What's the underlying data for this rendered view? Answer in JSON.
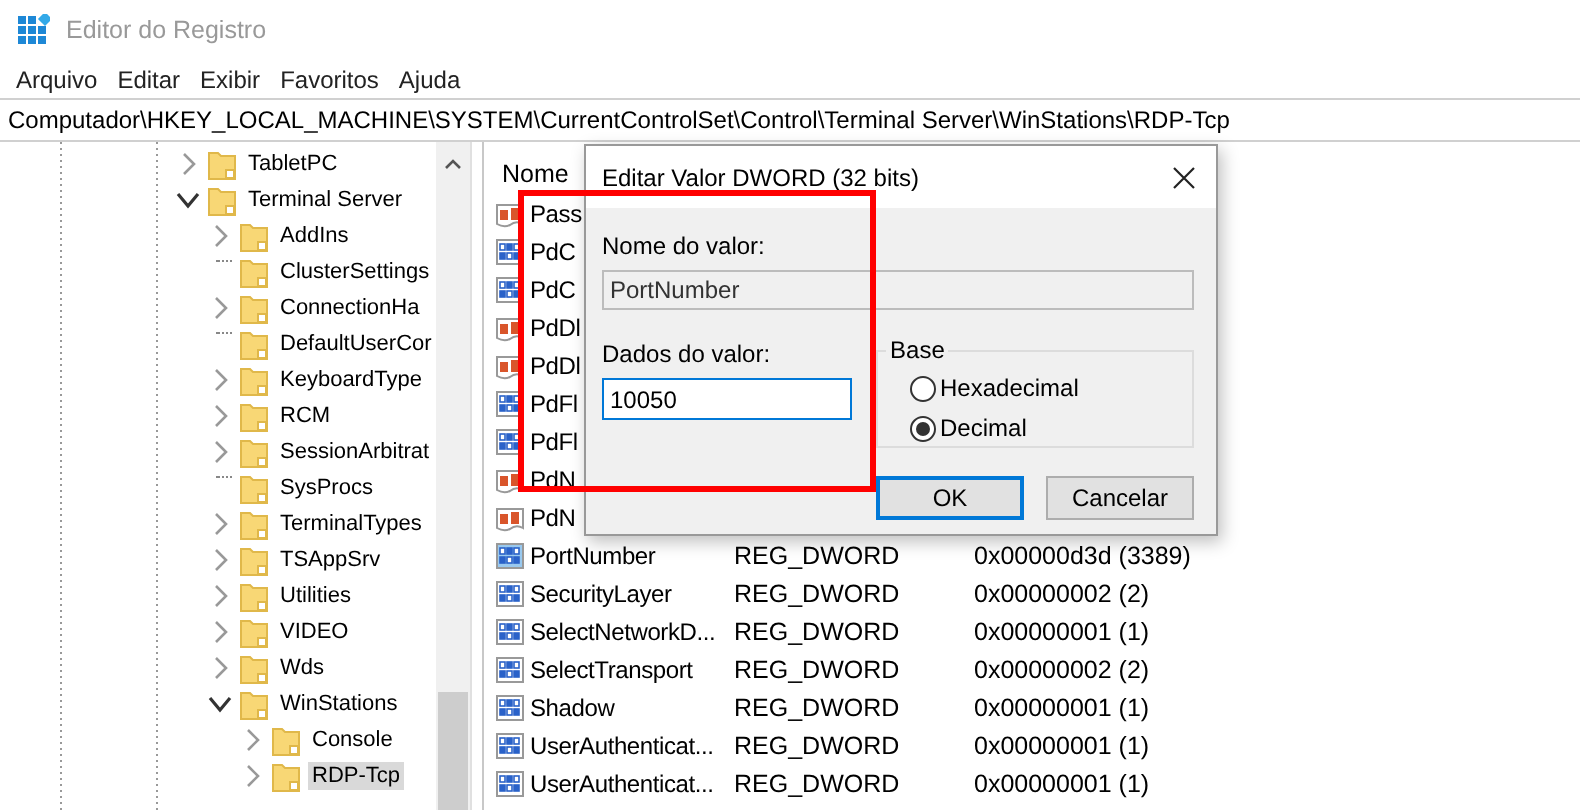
{
  "window": {
    "title": "Editor do Registro"
  },
  "menu": [
    "Arquivo",
    "Editar",
    "Exibir",
    "Favoritos",
    "Ajuda"
  ],
  "address_bar": {
    "value": "Computador\\HKEY_LOCAL_MACHINE\\SYSTEM\\CurrentControlSet\\Control\\Terminal Server\\WinStations\\RDP-Tcp"
  },
  "tree": {
    "items": [
      {
        "label": "TabletPC",
        "kind": "branch",
        "expanded": false,
        "selected": false
      },
      {
        "label": "Terminal Server",
        "kind": "branch",
        "expanded": true,
        "selected": false,
        "children": [
          {
            "label": "AddIns",
            "kind": "branch",
            "expanded": false,
            "selected": false
          },
          {
            "label": "ClusterSettings",
            "kind": "leaf",
            "selected": false
          },
          {
            "label": "ConnectionHa",
            "kind": "branch",
            "expanded": false,
            "selected": false
          },
          {
            "label": "DefaultUserCor",
            "kind": "leaf",
            "selected": false
          },
          {
            "label": "KeyboardType",
            "kind": "branch",
            "expanded": false,
            "selected": false
          },
          {
            "label": "RCM",
            "kind": "branch",
            "expanded": false,
            "selected": false
          },
          {
            "label": "SessionArbitrat",
            "kind": "branch",
            "expanded": false,
            "selected": false
          },
          {
            "label": "SysProcs",
            "kind": "leaf",
            "selected": false
          },
          {
            "label": "TerminalTypes",
            "kind": "branch",
            "expanded": false,
            "selected": false
          },
          {
            "label": "TSAppSrv",
            "kind": "branch",
            "expanded": false,
            "selected": false
          },
          {
            "label": "Utilities",
            "kind": "branch",
            "expanded": false,
            "selected": false
          },
          {
            "label": "VIDEO",
            "kind": "branch",
            "expanded": false,
            "selected": false
          },
          {
            "label": "Wds",
            "kind": "branch",
            "expanded": false,
            "selected": false
          },
          {
            "label": "WinStations",
            "kind": "branch",
            "expanded": true,
            "selected": false,
            "children": [
              {
                "label": "Console",
                "kind": "branch",
                "expanded": false,
                "selected": false
              },
              {
                "label": "RDP-Tcp",
                "kind": "branch",
                "expanded": false,
                "selected": true
              }
            ]
          }
        ]
      }
    ]
  },
  "values": {
    "columns": [
      "Nome"
    ],
    "rows": [
      {
        "name": "Pass",
        "kind": "string",
        "selected": false
      },
      {
        "name": "PdC",
        "kind": "dword",
        "selected": false
      },
      {
        "name": "PdC",
        "kind": "dword",
        "selected": false
      },
      {
        "name": "PdDl",
        "kind": "string",
        "selected": false
      },
      {
        "name": "PdDl",
        "kind": "string",
        "selected": false
      },
      {
        "name": "PdFl",
        "kind": "dword",
        "selected": false
      },
      {
        "name": "PdFl",
        "kind": "dword",
        "selected": false
      },
      {
        "name": "PdN",
        "kind": "string",
        "selected": false
      },
      {
        "name": "PdN",
        "kind": "string",
        "selected": false
      },
      {
        "name": "PortNumber",
        "kind": "dword",
        "type": "REG_DWORD",
        "data": "0x00000d3d (3389)",
        "selected": true
      },
      {
        "name": "SecurityLayer",
        "kind": "dword",
        "type": "REG_DWORD",
        "data": "0x00000002 (2)",
        "selected": false
      },
      {
        "name": "SelectNetworkD...",
        "kind": "dword",
        "type": "REG_DWORD",
        "data": "0x00000001 (1)",
        "selected": false
      },
      {
        "name": "SelectTransport",
        "kind": "dword",
        "type": "REG_DWORD",
        "data": "0x00000002 (2)",
        "selected": false
      },
      {
        "name": "Shadow",
        "kind": "dword",
        "type": "REG_DWORD",
        "data": "0x00000001 (1)",
        "selected": false
      },
      {
        "name": "UserAuthenticat...",
        "kind": "dword",
        "type": "REG_DWORD",
        "data": "0x00000001 (1)",
        "selected": false
      },
      {
        "name": "UserAuthenticat...",
        "kind": "dword",
        "type": "REG_DWORD",
        "data": "0x00000001 (1)",
        "selected": false
      }
    ]
  },
  "dialog": {
    "title": "Editar Valor DWORD (32 bits)",
    "name_label": "Nome do valor:",
    "name_value": "PortNumber",
    "data_label": "Dados do valor:",
    "data_value": "10050",
    "base": {
      "label": "Base",
      "options": [
        {
          "label": "Hexadecimal",
          "selected": false
        },
        {
          "label": "Decimal",
          "selected": true
        }
      ]
    },
    "buttons": [
      {
        "label": "OK",
        "default": true
      },
      {
        "label": "Cancelar",
        "default": false
      }
    ]
  },
  "annotation": {
    "kind": "frame"
  }
}
